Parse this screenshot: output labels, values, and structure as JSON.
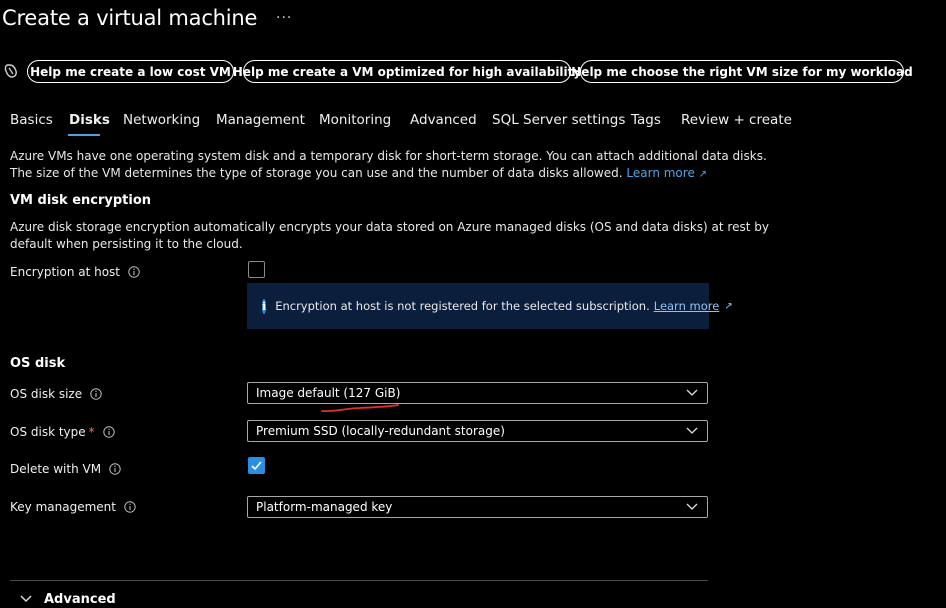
{
  "header": {
    "title": "Create a virtual machine",
    "more": "···"
  },
  "copilot": {
    "icon": "copilot-icon",
    "buttons": [
      "Help me create a low cost VM",
      "Help me create a VM optimized for high availability",
      "Help me choose the right VM size for my workload"
    ]
  },
  "tabs": [
    {
      "label": "Basics"
    },
    {
      "label": "Disks",
      "active": true
    },
    {
      "label": "Networking"
    },
    {
      "label": "Management"
    },
    {
      "label": "Monitoring"
    },
    {
      "label": "Advanced"
    },
    {
      "label": "SQL Server settings"
    },
    {
      "label": "Tags"
    },
    {
      "label": "Review + create"
    }
  ],
  "intro": {
    "line1": "Azure VMs have one operating system disk and a temporary disk for short-term storage. You can attach additional data disks.",
    "line2": "The size of the VM determines the type of storage you can use and the number of data disks allowed.",
    "learn_more": "Learn more"
  },
  "encryption": {
    "title": "VM disk encryption",
    "desc1": "Azure disk storage encryption automatically encrypts your data stored on Azure managed disks (OS and data disks) at rest by",
    "desc2": "default when persisting it to the cloud.",
    "host_label": "Encryption at host",
    "host_checked": false,
    "info_text": "Encryption at host is not registered for the selected subscription.",
    "info_link": "Learn more"
  },
  "os_disk": {
    "title": "OS disk",
    "size_label": "OS disk size",
    "size_value": "Image default (127 GiB)",
    "type_label": "OS disk type",
    "type_required": "*",
    "type_value": "Premium SSD (locally-redundant storage)",
    "delete_label": "Delete with VM",
    "delete_checked": true,
    "key_label": "Key management",
    "key_value": "Platform-managed key"
  },
  "advanced": {
    "label": "Advanced"
  },
  "colors": {
    "accent": "#2a8fe0",
    "link": "#4fa3e3",
    "info_bg": "#0b1e3b",
    "required": "#ff6b6b",
    "annotation": "#e0302a"
  }
}
